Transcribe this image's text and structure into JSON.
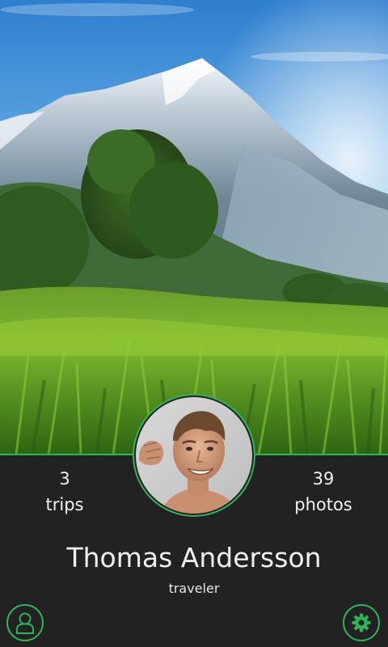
{
  "profile": {
    "name": "Thomas Andersson",
    "subtitle": "traveler",
    "avatar_description": "profile-photo"
  },
  "stats": {
    "trips": {
      "count": "3",
      "label": "trips"
    },
    "photos": {
      "count": "39",
      "label": "photos"
    }
  },
  "actions": {
    "profile_icon": "user-profile-icon",
    "settings_icon": "gear-icon"
  },
  "colors": {
    "accent": "#2fb35a",
    "panel_background": "#222222",
    "text": "#f0f0f0"
  }
}
